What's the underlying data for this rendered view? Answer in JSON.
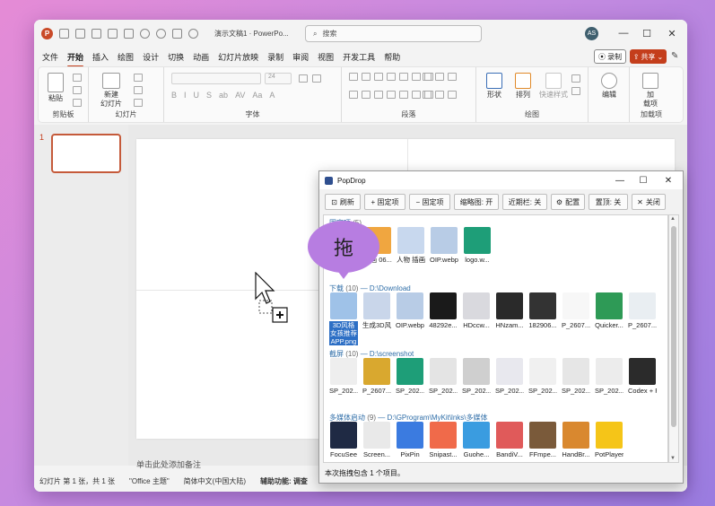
{
  "app": {
    "doc_title": "演示文稿1 · PowerPo...",
    "search_placeholder": "搜索",
    "user_initials": "AS"
  },
  "menu": [
    "文件",
    "开始",
    "插入",
    "绘图",
    "设计",
    "切换",
    "动画",
    "幻灯片放映",
    "录制",
    "审阅",
    "视图",
    "开发工具",
    "帮助"
  ],
  "menu_active": "开始",
  "record_label": "录制",
  "share_label": "共享",
  "ribbon": {
    "paste_label": "粘贴",
    "clipboard_group": "剪贴板",
    "new_slide_label1": "新建",
    "new_slide_label2": "幻灯片",
    "slides_group": "幻灯片",
    "font_group": "字体",
    "paragraph_group": "段落",
    "shape_label": "形状",
    "arrange_label": "排列",
    "quickstyle_label": "快速样式",
    "drawing_group": "绘图",
    "edit_label": "编辑",
    "addin_label1": "加",
    "addin_label2": "载项",
    "addin_group": "加载项",
    "font_buttons": [
      "B",
      "I",
      "U",
      "S",
      "ab",
      "AV",
      "Aa",
      "A"
    ],
    "font_size_value": "24"
  },
  "slides": {
    "number": "1"
  },
  "notes_placeholder": "单击此处添加备注",
  "status": {
    "slide_info": "幻灯片 第 1 张，共 1 张",
    "theme": "\"Office 主题\"",
    "language": "简体中文(中国大陆)",
    "accessibility": "辅助功能: 调查"
  },
  "popdrop": {
    "title": "PopDrop",
    "toolbar": [
      "刷新",
      "+ 固定项",
      "− 固定项",
      "缩略图: 开",
      "近期栏: 关",
      "配置",
      "置顶: 关",
      "关闭"
    ],
    "status_text": "本次拖拽包含 1 个项目。",
    "bubble_text": "拖",
    "sections": [
      {
        "title": "固定项",
        "count": "(5)",
        "path": "",
        "items": [
          {
            "label": "插画 06...",
            "color": "#f0a640"
          },
          {
            "label": "人物 插画 参考 10...",
            "color": "#c8d8ee"
          },
          {
            "label": "OIP.webp",
            "color": "#b8cce6"
          },
          {
            "label": "logo.w...",
            "color": "#1e9e78"
          }
        ]
      },
      {
        "title": "下载",
        "count": "(10)",
        "path": "D:\\Download",
        "items": [
          {
            "label": "3D风格女孩推荐APP.png",
            "color": "#9fc2e8",
            "selected": true
          },
          {
            "label": "生成3D风格豆包...",
            "color": "#c9d6ea"
          },
          {
            "label": "OIP.webp",
            "color": "#b8cce6"
          },
          {
            "label": "48292e...",
            "color": "#1a1a1a"
          },
          {
            "label": "HDccw...",
            "color": "#d9d9de"
          },
          {
            "label": "HNzam...",
            "color": "#2a2a2a"
          },
          {
            "label": "182906...",
            "color": "#333333"
          },
          {
            "label": "P_2607...",
            "color": "#f7f7f7"
          },
          {
            "label": "Quicker...",
            "color": "#2e9a56"
          },
          {
            "label": "P_2607...",
            "color": "#e9eef2"
          }
        ]
      },
      {
        "title": "截屏",
        "count": "(10)",
        "path": "D:\\screenshot",
        "items": [
          {
            "label": "SP_202...",
            "color": "#eeeeee"
          },
          {
            "label": "P_2607...",
            "color": "#d9a82f"
          },
          {
            "label": "SP_202...",
            "color": "#1e9e78"
          },
          {
            "label": "SP_202...",
            "color": "#e4e4e4"
          },
          {
            "label": "SP_202...",
            "color": "#cfcfcf"
          },
          {
            "label": "SP_202...",
            "color": "#e8e8ee"
          },
          {
            "label": "SP_202...",
            "color": "#f0f0f0"
          },
          {
            "label": "SP_202...",
            "color": "#e6e6e6"
          },
          {
            "label": "SP_202...",
            "color": "#ececec"
          },
          {
            "label": "Codex + Focuse...",
            "color": "#2b2b2b"
          }
        ]
      },
      {
        "title": "多媒体启动",
        "count": "(9)",
        "path": "D:\\GProgram\\MyKit\\lnks\\多媒体",
        "items": [
          {
            "label": "FocuSee",
            "color": "#1f2a44"
          },
          {
            "label": "Screen...",
            "color": "#e9e9e9"
          },
          {
            "label": "PixPin",
            "color": "#3b7be0"
          },
          {
            "label": "Snipast...",
            "color": "#f06a4a"
          },
          {
            "label": "Guohe...",
            "color": "#3a9ce0"
          },
          {
            "label": "BandiV...",
            "color": "#e05a5a"
          },
          {
            "label": "FFmpe...",
            "color": "#7a5a3a"
          },
          {
            "label": "HandBr...",
            "color": "#d9882f"
          },
          {
            "label": "PotPlayer",
            "color": "#f5c518"
          }
        ]
      }
    ]
  }
}
